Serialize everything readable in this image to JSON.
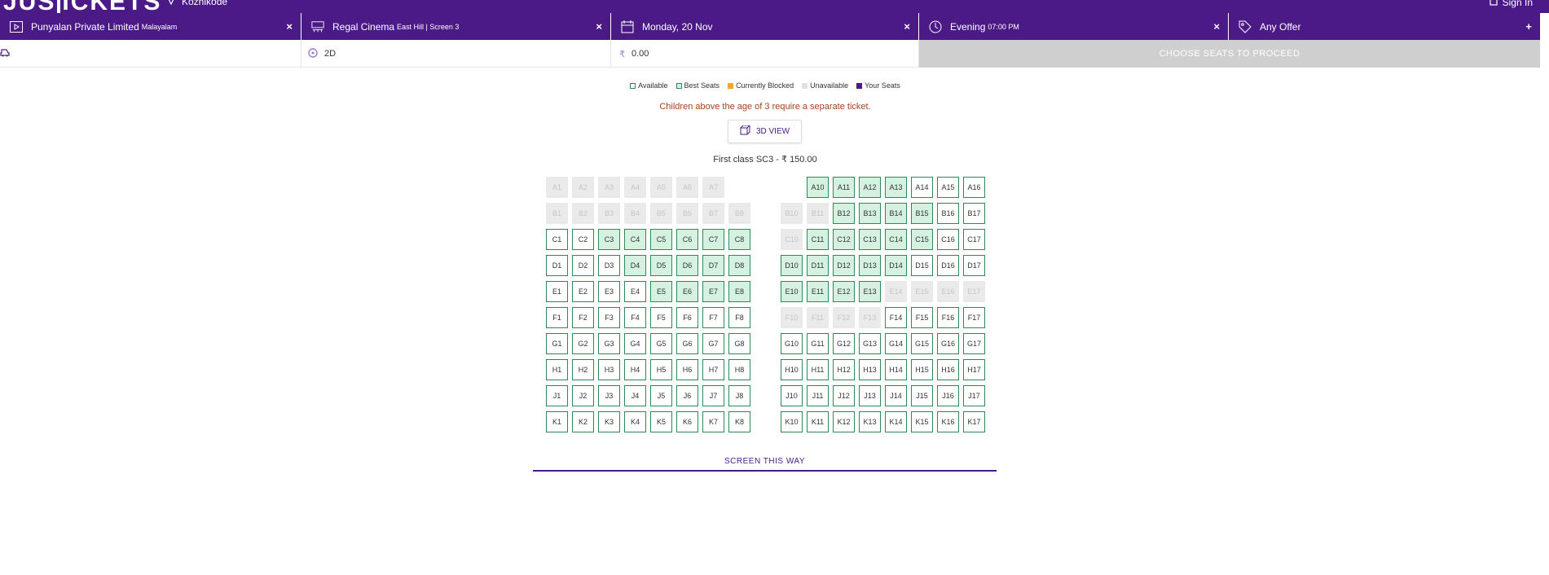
{
  "header": {
    "logo_left": "JUS",
    "logo_right": "ICKETS",
    "location": "Kozhikode",
    "signin": "Sign In"
  },
  "filters": [
    {
      "icon": "play-icon",
      "main": "Punyalan Private Limited",
      "sub": "Malayalam",
      "action": "×"
    },
    {
      "icon": "cinema-icon",
      "main": "Regal Cinema",
      "sub": "East Hill | Screen 3",
      "action": "×"
    },
    {
      "icon": "calendar-icon",
      "main": "Monday, 20 Nov",
      "sub": "",
      "action": "×"
    },
    {
      "icon": "clock-icon",
      "main": "Evening",
      "sub": "07:00 PM",
      "action": "×"
    },
    {
      "icon": "offer-tag-icon",
      "main": "Any Offer",
      "sub": "",
      "action": "+"
    }
  ],
  "info": {
    "format": "2D",
    "currency_symbol": "₹",
    "amount": "0.00",
    "proceed_label": "CHOOSE SEATS TO PROCEED"
  },
  "legend": [
    {
      "label": "Available",
      "color": "#ffffff",
      "border": "#2e8b57"
    },
    {
      "label": "Best Seats",
      "color": "#d4f1e1",
      "border": "#2e8b57"
    },
    {
      "label": "Currently Blocked",
      "color": "#f5a623",
      "border": "#f5a623"
    },
    {
      "label": "Unavailable",
      "color": "#e0e0e0",
      "border": "#e0e0e0"
    },
    {
      "label": "Your Seats",
      "color": "#4b1a86",
      "border": "#4b1a86"
    }
  ],
  "notice": "Children above the age of 3 require a separate ticket.",
  "view3d_label": "3D VIEW",
  "class_label": "First class SC3 - ₹ 150.00",
  "screen_label": "SCREEN THIS WAY",
  "colors": {
    "brand": "#4b1a86",
    "available_border": "#2e8b57",
    "best": "#d4f1e1",
    "unavailable": "#eaeaea",
    "notice": "#a04424"
  },
  "seat_rows": [
    {
      "row": "A",
      "left": [
        [
          "A1",
          "u"
        ],
        [
          "A2",
          "u"
        ],
        [
          "A3",
          "u"
        ],
        [
          "A4",
          "u"
        ],
        [
          "A5",
          "u"
        ],
        [
          "A6",
          "u"
        ],
        [
          "A7",
          "u"
        ],
        null
      ],
      "right": [
        null,
        [
          "A10",
          "b"
        ],
        [
          "A11",
          "b"
        ],
        [
          "A12",
          "b"
        ],
        [
          "A13",
          "b"
        ],
        [
          "A14",
          "a"
        ],
        [
          "A15",
          "a"
        ],
        [
          "A16",
          "a"
        ]
      ]
    },
    {
      "row": "B",
      "left": [
        [
          "B1",
          "u"
        ],
        [
          "B2",
          "u"
        ],
        [
          "B3",
          "u"
        ],
        [
          "B4",
          "u"
        ],
        [
          "B5",
          "u"
        ],
        [
          "B6",
          "u"
        ],
        [
          "B7",
          "u"
        ],
        [
          "B8",
          "u"
        ]
      ],
      "right": [
        [
          "B10",
          "u"
        ],
        [
          "B11",
          "u"
        ],
        [
          "B12",
          "b"
        ],
        [
          "B13",
          "b"
        ],
        [
          "B14",
          "b"
        ],
        [
          "B15",
          "b"
        ],
        [
          "B16",
          "a"
        ],
        [
          "B17",
          "a"
        ]
      ]
    },
    {
      "row": "C",
      "left": [
        [
          "C1",
          "a"
        ],
        [
          "C2",
          "a"
        ],
        [
          "C3",
          "b"
        ],
        [
          "C4",
          "b"
        ],
        [
          "C5",
          "b"
        ],
        [
          "C6",
          "b"
        ],
        [
          "C7",
          "b"
        ],
        [
          "C8",
          "b"
        ]
      ],
      "right": [
        [
          "C10",
          "u"
        ],
        [
          "C11",
          "b"
        ],
        [
          "C12",
          "b"
        ],
        [
          "C13",
          "b"
        ],
        [
          "C14",
          "b"
        ],
        [
          "C15",
          "b"
        ],
        [
          "C16",
          "a"
        ],
        [
          "C17",
          "a"
        ]
      ]
    },
    {
      "row": "D",
      "left": [
        [
          "D1",
          "a"
        ],
        [
          "D2",
          "a"
        ],
        [
          "D3",
          "a"
        ],
        [
          "D4",
          "b"
        ],
        [
          "D5",
          "b"
        ],
        [
          "D6",
          "b"
        ],
        [
          "D7",
          "b"
        ],
        [
          "D8",
          "b"
        ]
      ],
      "right": [
        [
          "D10",
          "b"
        ],
        [
          "D11",
          "b"
        ],
        [
          "D12",
          "b"
        ],
        [
          "D13",
          "b"
        ],
        [
          "D14",
          "b"
        ],
        [
          "D15",
          "a"
        ],
        [
          "D16",
          "a"
        ],
        [
          "D17",
          "a"
        ]
      ]
    },
    {
      "row": "E",
      "left": [
        [
          "E1",
          "a"
        ],
        [
          "E2",
          "a"
        ],
        [
          "E3",
          "a"
        ],
        [
          "E4",
          "a"
        ],
        [
          "E5",
          "b"
        ],
        [
          "E6",
          "b"
        ],
        [
          "E7",
          "b"
        ],
        [
          "E8",
          "b"
        ]
      ],
      "right": [
        [
          "E10",
          "b"
        ],
        [
          "E11",
          "b"
        ],
        [
          "E12",
          "b"
        ],
        [
          "E13",
          "b"
        ],
        [
          "E14",
          "u"
        ],
        [
          "E15",
          "u"
        ],
        [
          "E16",
          "u"
        ],
        [
          "E17",
          "u"
        ]
      ]
    },
    {
      "row": "F",
      "left": [
        [
          "F1",
          "a"
        ],
        [
          "F2",
          "a"
        ],
        [
          "F3",
          "a"
        ],
        [
          "F4",
          "a"
        ],
        [
          "F5",
          "a"
        ],
        [
          "F6",
          "a"
        ],
        [
          "F7",
          "a"
        ],
        [
          "F8",
          "a"
        ]
      ],
      "right": [
        [
          "F10",
          "u"
        ],
        [
          "F11",
          "u"
        ],
        [
          "F12",
          "u"
        ],
        [
          "F13",
          "u"
        ],
        [
          "F14",
          "a"
        ],
        [
          "F15",
          "a"
        ],
        [
          "F16",
          "a"
        ],
        [
          "F17",
          "a"
        ]
      ]
    },
    {
      "row": "G",
      "left": [
        [
          "G1",
          "a"
        ],
        [
          "G2",
          "a"
        ],
        [
          "G3",
          "a"
        ],
        [
          "G4",
          "a"
        ],
        [
          "G5",
          "a"
        ],
        [
          "G6",
          "a"
        ],
        [
          "G7",
          "a"
        ],
        [
          "G8",
          "a"
        ]
      ],
      "right": [
        [
          "G10",
          "a"
        ],
        [
          "G11",
          "a"
        ],
        [
          "G12",
          "a"
        ],
        [
          "G13",
          "a"
        ],
        [
          "G14",
          "a"
        ],
        [
          "G15",
          "a"
        ],
        [
          "G16",
          "a"
        ],
        [
          "G17",
          "a"
        ]
      ]
    },
    {
      "row": "H",
      "left": [
        [
          "H1",
          "a"
        ],
        [
          "H2",
          "a"
        ],
        [
          "H3",
          "a"
        ],
        [
          "H4",
          "a"
        ],
        [
          "H5",
          "a"
        ],
        [
          "H6",
          "a"
        ],
        [
          "H7",
          "a"
        ],
        [
          "H8",
          "a"
        ]
      ],
      "right": [
        [
          "H10",
          "a"
        ],
        [
          "H11",
          "a"
        ],
        [
          "H12",
          "a"
        ],
        [
          "H13",
          "a"
        ],
        [
          "H14",
          "a"
        ],
        [
          "H15",
          "a"
        ],
        [
          "H16",
          "a"
        ],
        [
          "H17",
          "a"
        ]
      ]
    },
    {
      "row": "J",
      "left": [
        [
          "J1",
          "a"
        ],
        [
          "J2",
          "a"
        ],
        [
          "J3",
          "a"
        ],
        [
          "J4",
          "a"
        ],
        [
          "J5",
          "a"
        ],
        [
          "J6",
          "a"
        ],
        [
          "J7",
          "a"
        ],
        [
          "J8",
          "a"
        ]
      ],
      "right": [
        [
          "J10",
          "a"
        ],
        [
          "J11",
          "a"
        ],
        [
          "J12",
          "a"
        ],
        [
          "J13",
          "a"
        ],
        [
          "J14",
          "a"
        ],
        [
          "J15",
          "a"
        ],
        [
          "J16",
          "a"
        ],
        [
          "J17",
          "a"
        ]
      ]
    },
    {
      "row": "K",
      "left": [
        [
          "K1",
          "a"
        ],
        [
          "K2",
          "a"
        ],
        [
          "K3",
          "a"
        ],
        [
          "K4",
          "a"
        ],
        [
          "K5",
          "a"
        ],
        [
          "K6",
          "a"
        ],
        [
          "K7",
          "a"
        ],
        [
          "K8",
          "a"
        ]
      ],
      "right": [
        [
          "K10",
          "a"
        ],
        [
          "K11",
          "a"
        ],
        [
          "K12",
          "a"
        ],
        [
          "K13",
          "a"
        ],
        [
          "K14",
          "a"
        ],
        [
          "K15",
          "a"
        ],
        [
          "K16",
          "a"
        ],
        [
          "K17",
          "a"
        ]
      ]
    }
  ]
}
